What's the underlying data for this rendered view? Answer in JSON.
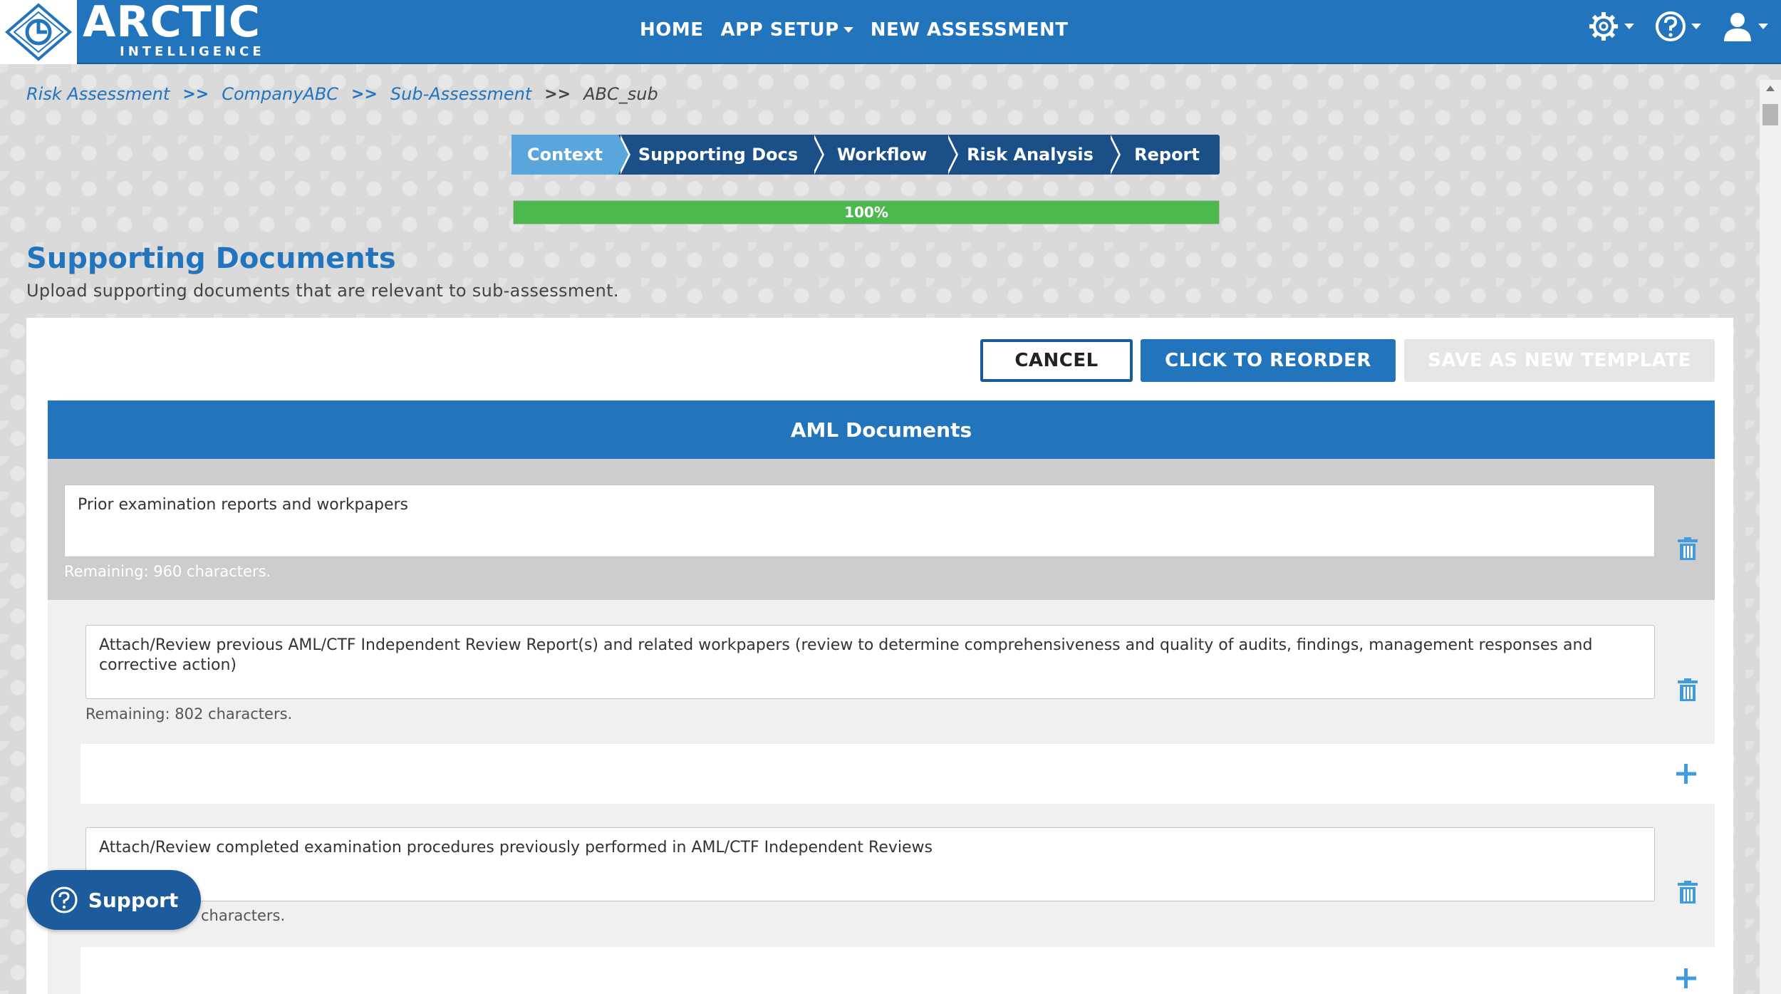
{
  "brand": {
    "name": "ARCTIC",
    "tagline": "INTELLIGENCE"
  },
  "nav": {
    "home": "HOME",
    "app_setup": "APP SETUP",
    "new_assessment": "NEW ASSESSMENT"
  },
  "breadcrumb": {
    "items": [
      "Risk Assessment",
      "CompanyABC",
      "Sub-Assessment"
    ],
    "separator": ">>",
    "current": "ABC_sub"
  },
  "stepper": {
    "steps": [
      "Context",
      "Supporting Docs",
      "Workflow",
      "Risk Analysis",
      "Report"
    ],
    "active_step": "Context"
  },
  "progress": {
    "label": "100%",
    "value": 1.0
  },
  "page": {
    "title": "Supporting Documents",
    "subtitle": "Upload supporting documents that are relevant to sub-assessment."
  },
  "actions": {
    "cancel": "CANCEL",
    "reorder": "CLICK TO REORDER",
    "save_template": "SAVE AS NEW TEMPLATE"
  },
  "section": {
    "title": "AML Documents",
    "parent_item": {
      "text": "Prior examination reports and workpapers",
      "remaining": "Remaining: 960 characters."
    },
    "children": [
      {
        "text": "Attach/Review previous AML/CTF Independent Review Report(s) and related workpapers (review to determine comprehensiveness and quality of audits, findings, management responses and corrective action)",
        "remaining": "Remaining: 802 characters."
      },
      {
        "text": "Attach/Review completed examination procedures previously performed in AML/CTF Independent Reviews",
        "remaining_visible": "characters."
      }
    ]
  },
  "support": {
    "label": "Support"
  },
  "colors": {
    "brand_blue": "#2274bd",
    "progress_green": "#4cb84e",
    "active_step": "#5aa5dc",
    "step_dark": "#1a4f88"
  }
}
